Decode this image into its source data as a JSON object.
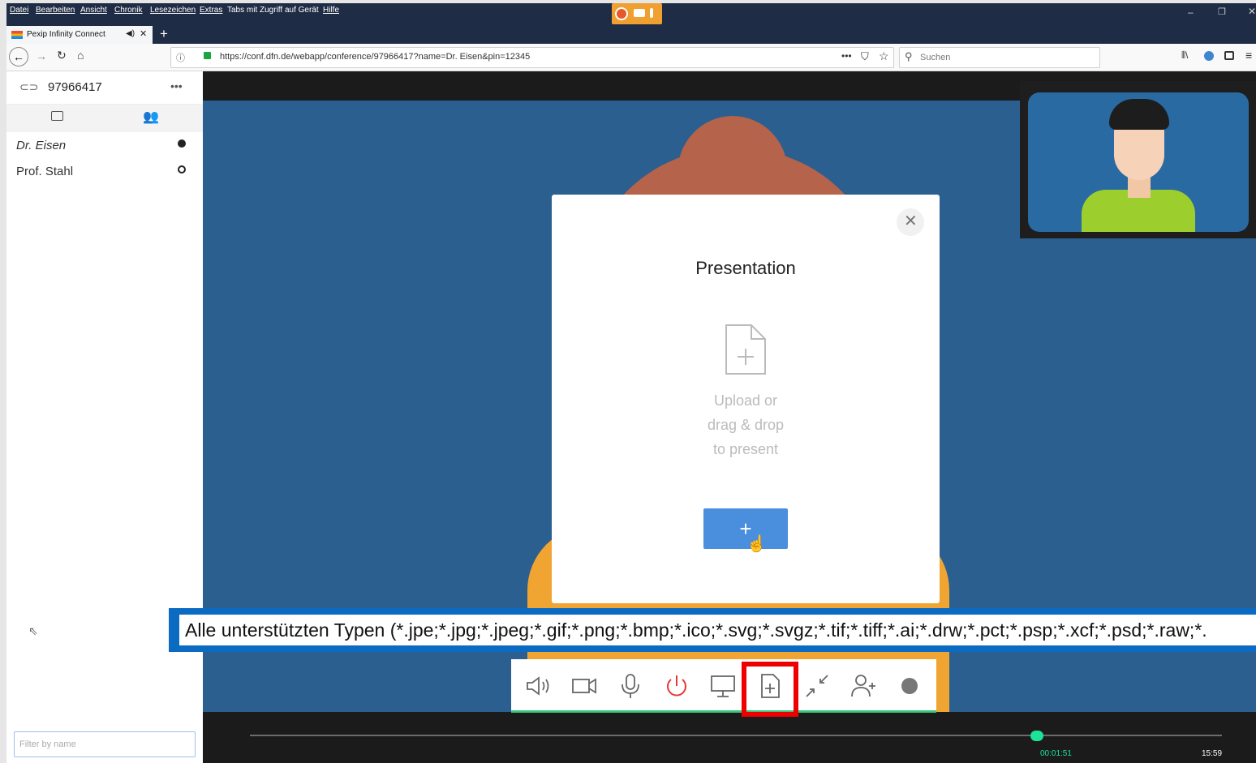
{
  "browser": {
    "menu": [
      "Datei",
      "Bearbeiten",
      "Ansicht",
      "Chronik",
      "Lesezeichen",
      "Extras",
      "Tabs mit Zugriff auf Gerät",
      "Hilfe"
    ],
    "tab_title": "Pexip Infinity Connect",
    "url": "https://conf.dfn.de/webapp/conference/97966417?name=Dr. Eisen&pin=12345",
    "search_placeholder": "Suchen"
  },
  "sidebar": {
    "conference_id": "97966417",
    "participants": [
      {
        "name": "Dr. Eisen"
      },
      {
        "name": "Prof. Stahl"
      }
    ],
    "filter_placeholder": "Filter by name"
  },
  "dialog": {
    "title": "Presentation",
    "hint_lines": [
      "Upload or",
      "drag & drop",
      "to present"
    ],
    "add_button": "+"
  },
  "tooltip": {
    "text": "Alle unterstützten Typen (*.jpe;*.jpg;*.jpeg;*.gif;*.png;*.bmp;*.ico;*.svg;*.svgz;*.tif;*.tiff;*.ai;*.drw;*.pct;*.psp;*.xcf;*.psd;*.raw;*."
  },
  "player": {
    "elapsed": "00:01:51",
    "total": "15:59",
    "progress_fraction": 0.81
  },
  "colors": {
    "accent": "#4a8fde",
    "hangup": "#e53935",
    "highlight": "#ee0000",
    "progress": "#1de29a",
    "stage": "#2a5f8f"
  },
  "icons": [
    "speaker-icon",
    "camera-icon",
    "microphone-icon",
    "power-icon",
    "screen-share-icon",
    "present-file-icon",
    "minimize-icon",
    "add-participant-icon",
    "record-icon"
  ]
}
